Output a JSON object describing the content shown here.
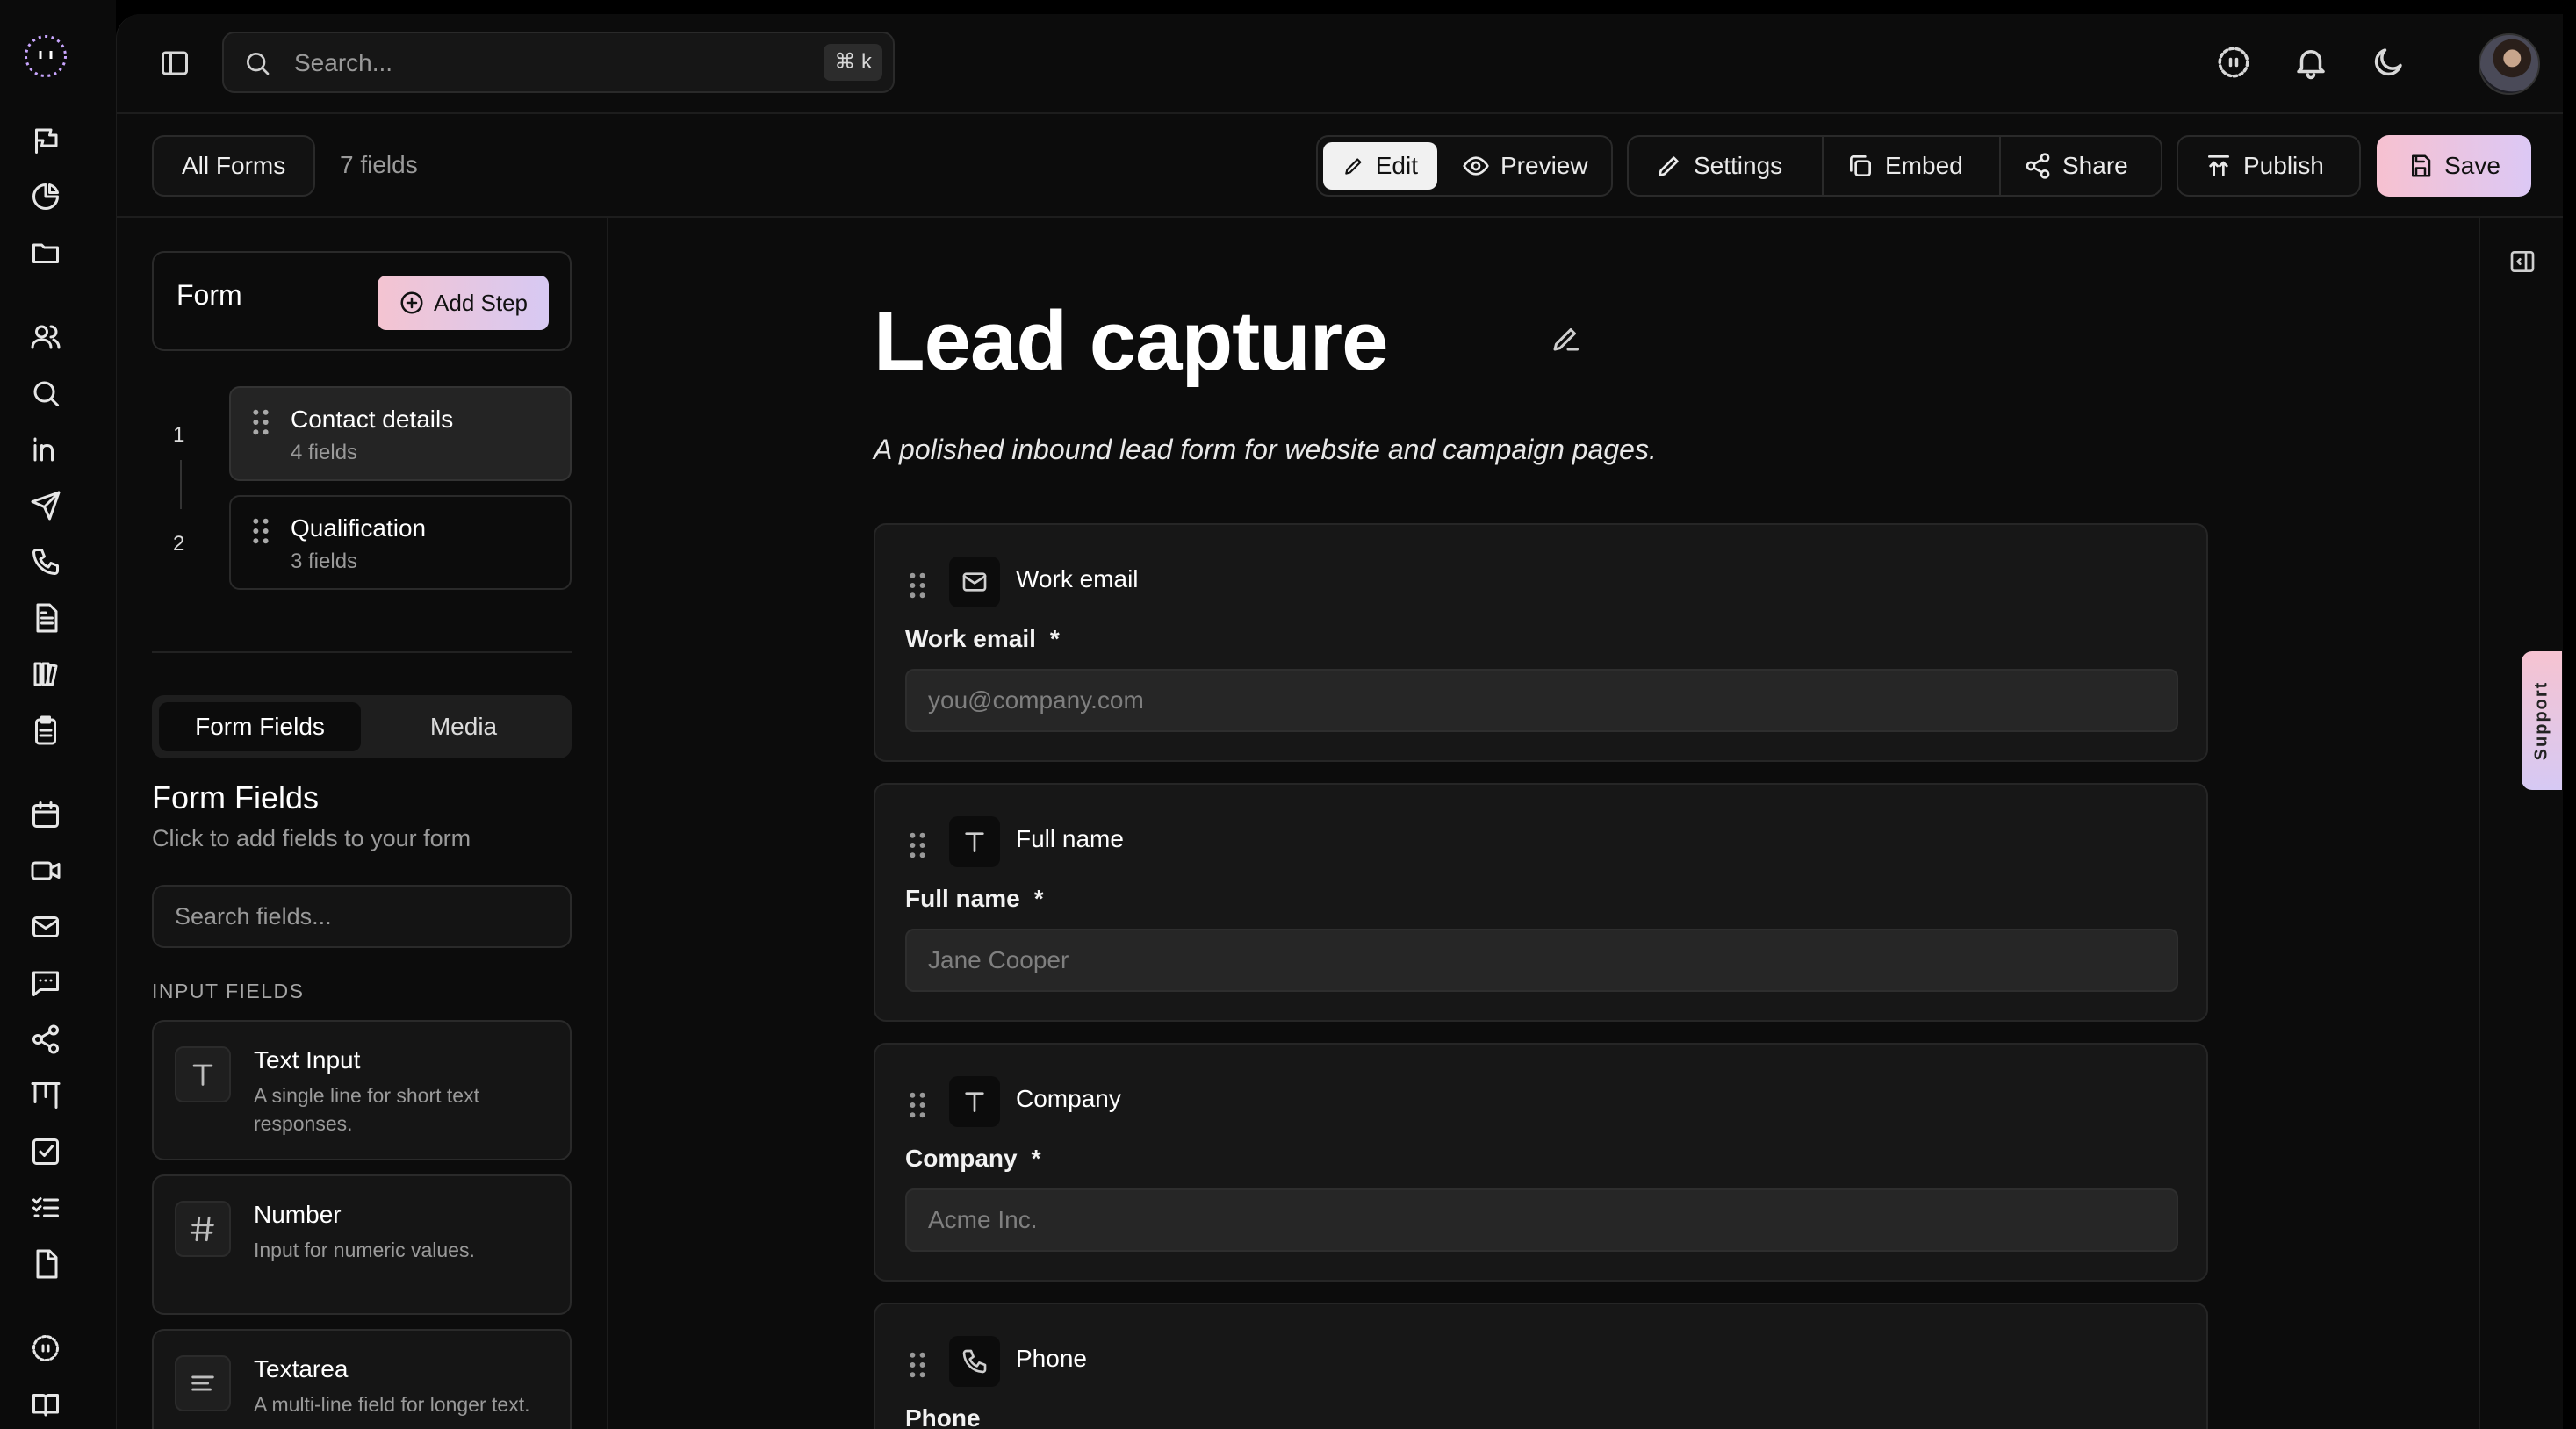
{
  "app": {
    "search": {
      "placeholder": "Search...",
      "shortcut": "⌘ k"
    }
  },
  "rail": {
    "icons": [
      "logo-icon",
      "flag-icon",
      "pie-chart-icon",
      "folder-icon",
      "users-icon",
      "search-icon",
      "linkedin-icon",
      "send-icon",
      "phone-icon",
      "document-icon",
      "library-icon",
      "clipboard-icon",
      "calendar-icon",
      "video-icon",
      "mail-icon",
      "message-icon",
      "share-icon",
      "kanban-icon",
      "checkbox-icon",
      "list-check-icon",
      "file-icon",
      "logo-icon",
      "book-icon"
    ]
  },
  "toolbar": {
    "all_forms": "All Forms",
    "field_count": "7 fields",
    "edit": "Edit",
    "preview": "Preview",
    "settings": "Settings",
    "embed": "Embed",
    "share": "Share",
    "publish": "Publish",
    "save": "Save"
  },
  "panel": {
    "form_label": "Form",
    "add_step": "Add Step",
    "steps": [
      {
        "num": "1",
        "name": "Contact details",
        "sub": "4 fields",
        "active": true
      },
      {
        "num": "2",
        "name": "Qualification",
        "sub": "3 fields",
        "active": false
      }
    ],
    "tabs": [
      "Form Fields",
      "Media"
    ],
    "fields_title": "Form Fields",
    "fields_subtitle": "Click to add fields to your form",
    "fields_search_placeholder": "Search fields...",
    "section_label": "INPUT FIELDS",
    "field_types": [
      {
        "name": "Text Input",
        "desc": "A single line for short text responses.",
        "icon": "text-icon"
      },
      {
        "name": "Number",
        "desc": "Input for numeric values.",
        "icon": "hash-icon"
      },
      {
        "name": "Textarea",
        "desc": "A multi-line field for longer text.",
        "icon": "textarea-icon"
      }
    ]
  },
  "form": {
    "title": "Lead capture",
    "description": "A polished inbound lead form for website and campaign pages.",
    "questions": [
      {
        "header": "Work email",
        "label": "Work email",
        "required": "*",
        "placeholder": "you@company.com",
        "icon": "mail-icon"
      },
      {
        "header": "Full name",
        "label": "Full name",
        "required": "*",
        "placeholder": "Jane Cooper",
        "icon": "text-icon"
      },
      {
        "header": "Company",
        "label": "Company",
        "required": "*",
        "placeholder": "Acme Inc.",
        "icon": "text-icon"
      },
      {
        "header": "Phone",
        "label": "Phone",
        "required": "",
        "placeholder": "",
        "icon": "phone-icon"
      }
    ]
  },
  "support": {
    "label": "Support"
  }
}
